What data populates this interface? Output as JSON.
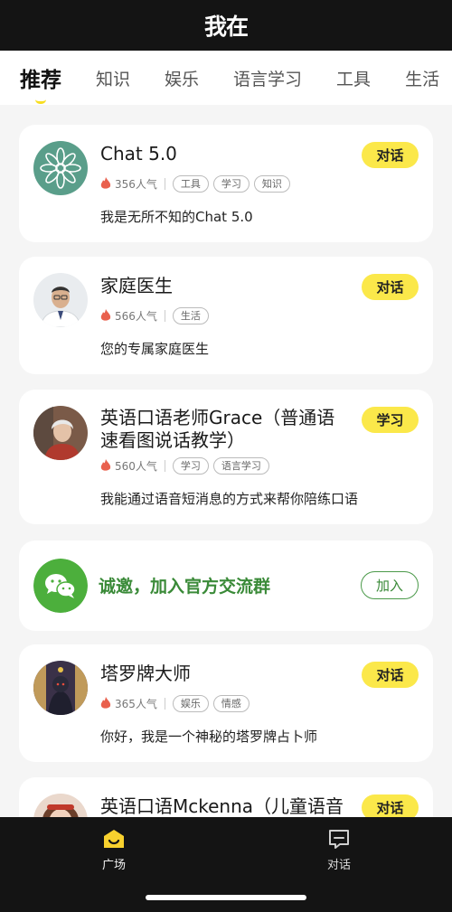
{
  "app": {
    "logo": "我在"
  },
  "tabs": [
    {
      "label": "推荐"
    },
    {
      "label": "知识"
    },
    {
      "label": "娱乐"
    },
    {
      "label": "语言学习"
    },
    {
      "label": "工具"
    },
    {
      "label": "生活"
    }
  ],
  "cards": [
    {
      "title": "Chat 5.0",
      "popularity": "356人气",
      "tags": [
        "工具",
        "学习",
        "知识"
      ],
      "description": "我是无所不知的Chat 5.0",
      "button": "对话"
    },
    {
      "title": "家庭医生",
      "popularity": "566人气",
      "tags": [
        "生活"
      ],
      "description": "您的专属家庭医生",
      "button": "对话"
    },
    {
      "title_line1": "英语口语老师Grace（普通语",
      "title_line2": "速看图说话教学）",
      "popularity": "560人气",
      "tags": [
        "学习",
        "语言学习"
      ],
      "description": "我能通过语音短消息的方式来帮你陪练口语",
      "button": "学习"
    },
    {
      "title": "塔罗牌大师",
      "popularity": "365人气",
      "tags": [
        "娱乐",
        "情感"
      ],
      "description": "你好，我是一个神秘的塔罗牌占卜师",
      "button": "对话"
    },
    {
      "title": "英语口语Mckenna（儿童语音",
      "button": "对话"
    }
  ],
  "promo": {
    "text": "诚邀，加入官方交流群",
    "button": "加入"
  },
  "bottom_nav": [
    {
      "label": "广场",
      "icon": "square-home-icon",
      "active": true
    },
    {
      "label": "对话",
      "icon": "chat-icon",
      "active": false
    }
  ],
  "colors": {
    "accent_yellow": "#fbe84a",
    "wechat_green": "#3a8a38",
    "dark_bar": "#141414"
  }
}
